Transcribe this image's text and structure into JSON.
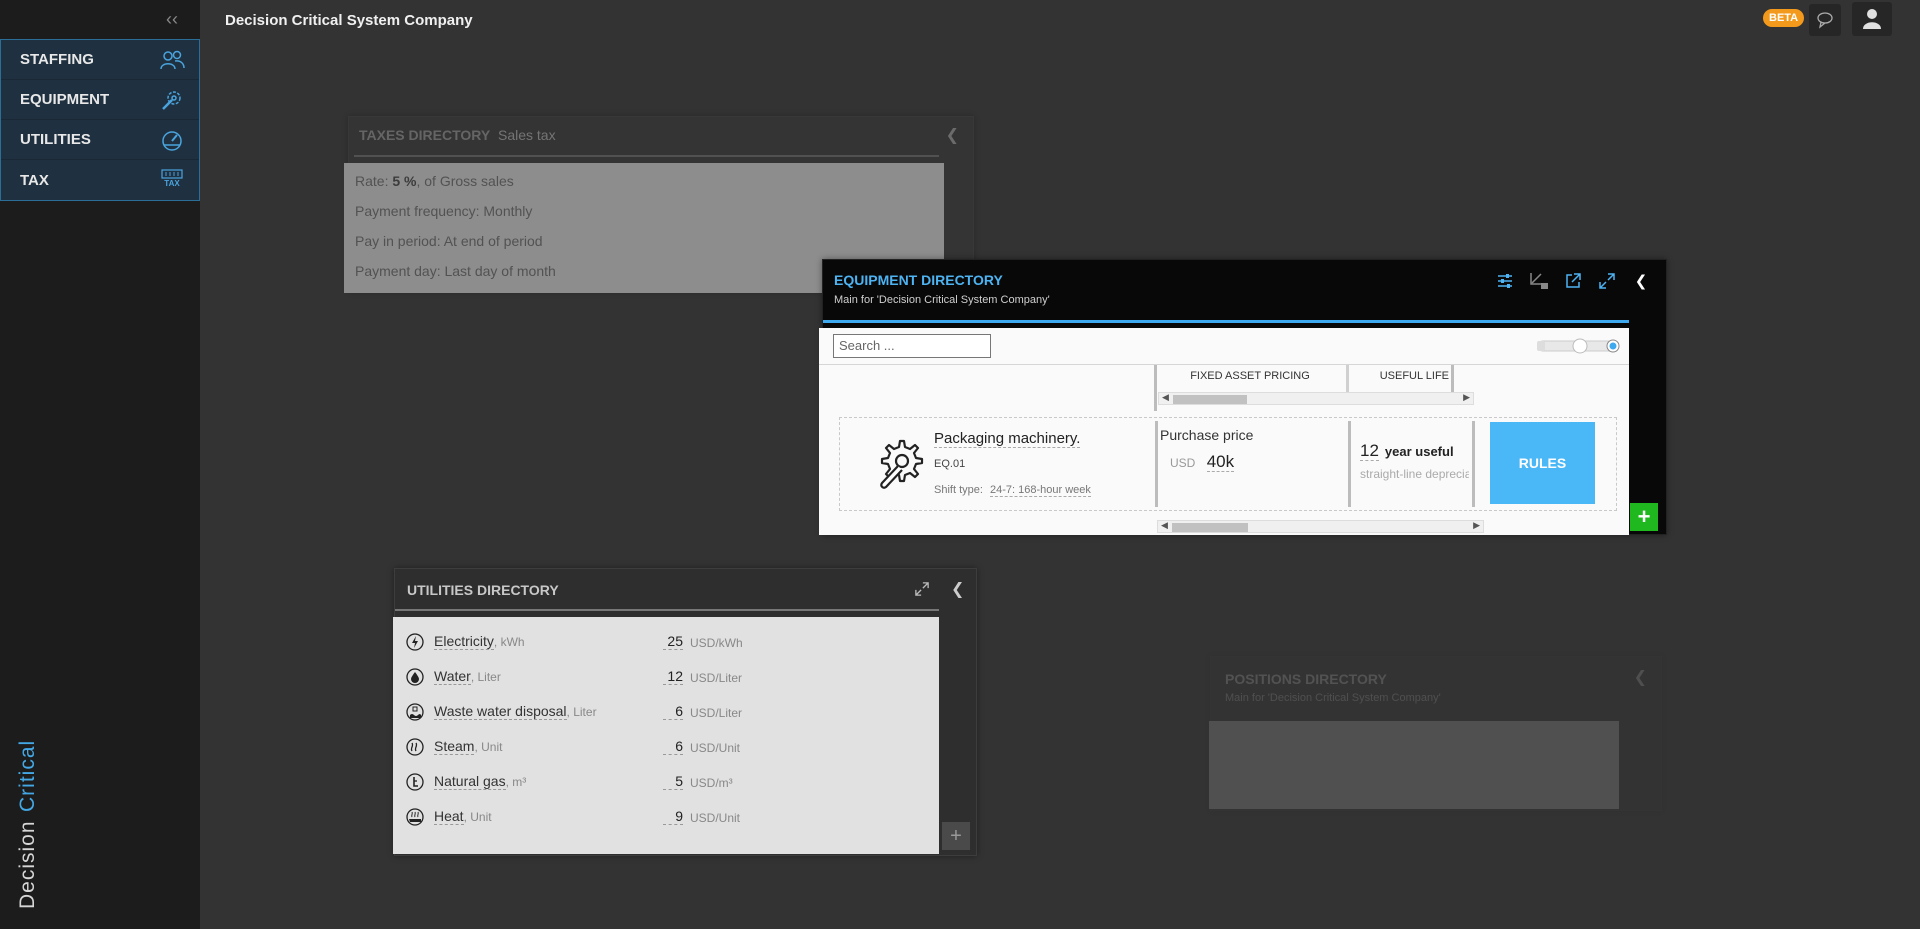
{
  "app": {
    "company": "Decision Critical System Company",
    "beta_badge": "BETA"
  },
  "sidebar": {
    "items": [
      {
        "label": "STAFFING",
        "icon": "people-icon"
      },
      {
        "label": "EQUIPMENT",
        "icon": "wrench-gear-icon"
      },
      {
        "label": "UTILITIES",
        "icon": "gauge-icon"
      },
      {
        "label": "TAX",
        "icon": "tax-icon",
        "icon_text": "TAX"
      }
    ],
    "brand_word1": "Decision",
    "brand_word2": "Critical"
  },
  "taxes": {
    "title": "TAXES DIRECTORY",
    "subtitle": "Sales tax",
    "rate_prefix": "Rate:",
    "rate_value": "5 %",
    "rate_suffix": ", of Gross sales",
    "payment_frequency": "Payment frequency: Monthly",
    "pay_in_period": "Pay in period: At end of period",
    "payment_day": "Payment day: Last day of month"
  },
  "equipment": {
    "title": "EQUIPMENT DIRECTORY",
    "subtitle": "Main for 'Decision Critical System Company'",
    "search_placeholder": "Search ...",
    "col_pricing": "FIXED ASSET PRICING",
    "col_life": "USEFUL LIFE",
    "item": {
      "name": "Packaging machinery.",
      "code": "EQ.01",
      "shift_label": "Shift type:",
      "shift_value": "24-7: 168-hour week",
      "price_label": "Purchase price",
      "currency": "USD",
      "price": "40k",
      "life_value": "12",
      "life_unit": "year useful",
      "life_sub": "straight-line depreciation"
    },
    "rules_button": "RULES",
    "add_button": "+"
  },
  "utilities": {
    "title": "UTILITIES DIRECTORY",
    "add_button": "+",
    "rows": [
      {
        "name": "Electricity",
        "unit": ", kWh",
        "value": "25",
        "value_unit": "USD/kWh",
        "icon": "lightning-icon"
      },
      {
        "name": "Water",
        "unit": ", Liter",
        "value": "12",
        "value_unit": "USD/Liter",
        "icon": "water-drop-icon"
      },
      {
        "name": "Waste water disposal",
        "unit": ", Liter",
        "value": "6",
        "value_unit": "USD/Liter",
        "icon": "waste-water-icon"
      },
      {
        "name": "Steam",
        "unit": ", Unit",
        "value": "6",
        "value_unit": "USD/Unit",
        "icon": "steam-icon"
      },
      {
        "name": "Natural gas",
        "unit": ", m³",
        "value": "5",
        "value_unit": "USD/m³",
        "icon": "gas-icon"
      },
      {
        "name": "Heat",
        "unit": ", Unit",
        "value": "9",
        "value_unit": "USD/Unit",
        "icon": "heat-icon"
      }
    ]
  },
  "positions": {
    "title": "POSITIONS DIRECTORY",
    "subtitle": "Main for 'Decision Critical System Company'"
  },
  "colors": {
    "accent": "#3fa9f0",
    "beta": "#f39a1c",
    "add_green": "#1fb81f",
    "rules": "#4ab7f7"
  }
}
